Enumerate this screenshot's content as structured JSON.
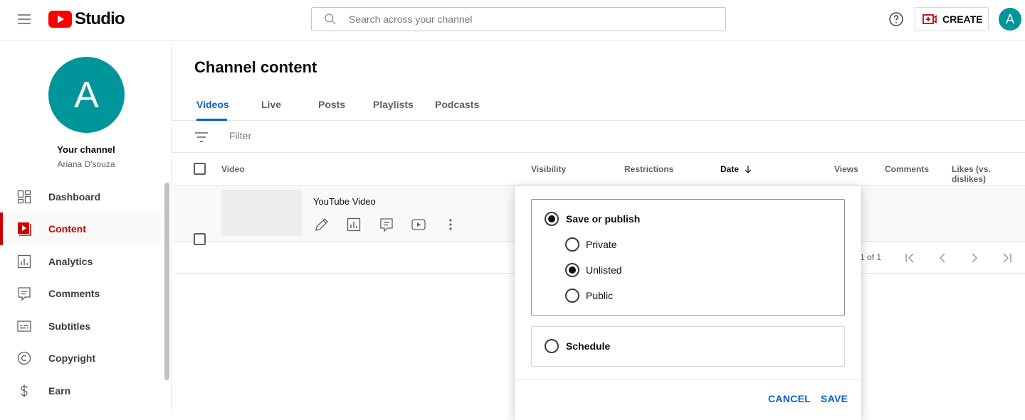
{
  "header": {
    "logo_text": "Studio",
    "search_placeholder": "Search across your channel",
    "create_label": "CREATE",
    "avatar_letter": "A",
    "brand_color": "#ff0000",
    "avatar_color": "#00959b"
  },
  "sidebar": {
    "avatar_letter": "A",
    "channel_title": "Your channel",
    "channel_name": "Ariana D'souza",
    "items": [
      {
        "label": "Dashboard",
        "icon": "dashboard-icon"
      },
      {
        "label": "Content",
        "icon": "content-icon",
        "active": true
      },
      {
        "label": "Analytics",
        "icon": "analytics-icon"
      },
      {
        "label": "Comments",
        "icon": "comments-icon"
      },
      {
        "label": "Subtitles",
        "icon": "subtitles-icon"
      },
      {
        "label": "Copyright",
        "icon": "copyright-icon"
      },
      {
        "label": "Earn",
        "icon": "earn-icon"
      }
    ]
  },
  "main": {
    "title": "Channel content",
    "tabs": [
      {
        "label": "Videos",
        "active": true
      },
      {
        "label": "Live"
      },
      {
        "label": "Posts"
      },
      {
        "label": "Playlists"
      },
      {
        "label": "Podcasts"
      }
    ],
    "filter_placeholder": "Filter",
    "columns": {
      "video": "Video",
      "visibility": "Visibility",
      "restrictions": "Restrictions",
      "date": "Date",
      "views": "Views",
      "comments": "Comments",
      "likes": "Likes (vs. dislikes)"
    },
    "rows": [
      {
        "title": "YouTube Video"
      }
    ],
    "pagination": "1 of 1"
  },
  "visibility_popup": {
    "save_or_publish": "Save or publish",
    "options": [
      {
        "label": "Private",
        "selected": false
      },
      {
        "label": "Unlisted",
        "selected": true
      },
      {
        "label": "Public",
        "selected": false
      }
    ],
    "schedule": "Schedule",
    "cancel": "CANCEL",
    "save": "SAVE",
    "accent_color": "#065fd4"
  }
}
